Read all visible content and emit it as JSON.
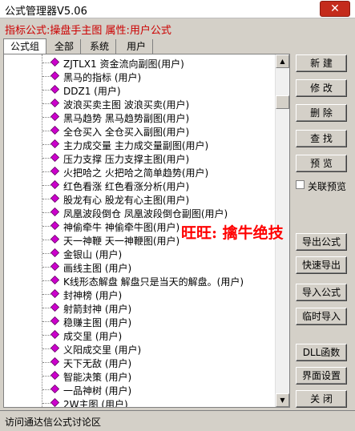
{
  "window": {
    "title": "公式管理器V5.06",
    "close_label": "✕"
  },
  "header": {
    "formula_info": "指标公式:操盘手主图 属性:用户公式"
  },
  "tabs": [
    "公式组",
    "全部",
    "系统",
    "用户"
  ],
  "tree": {
    "node_icon_color": "#cc00cc",
    "items": [
      "ZJTLX1 资金流向副图(用户)",
      "黑马的指标 (用户)",
      "DDZ1 (用户)",
      "波浪买卖主图 波浪买卖(用户)",
      "黑马趋势 黑马趋势副图(用户)",
      "全仓买入 全仓买入副图(用户)",
      "主力成交量 主力成交量副图(用户)",
      "压力支撑 压力支撑主图(用户)",
      "火把哈之 火把哈之简单趋势(用户)",
      "红色看涨 红色看涨分析(用户)",
      "股龙有心 股龙有心主图(用户)",
      "凤凰波段倒仓 凤凰波段倒仓副图(用户)",
      "神偷牵牛 神偷牵牛图(用户)",
      "天一神鞭 天一神鞭图(用户)",
      "金银山 (用户)",
      "画线主图 (用户)",
      "K线形态解盘 解盘只是当天的解盘。(用户)",
      "封神榜 (用户)",
      "射箭封神 (用户)",
      "稳赚主图 (用户)",
      "成交里 (用户)",
      "义阳成交里 (用户)",
      "天下无敌 (用户)",
      "智能决策 (用户)",
      "一品神树 (用户)",
      "2W主图 (用户)"
    ]
  },
  "buttons": {
    "new": "新 建",
    "modify": "修 改",
    "delete": "删 除",
    "find": "查 找",
    "preview": "预 览",
    "link_preview": "关联预览",
    "export": "导出公式",
    "quick_export": "快速导出",
    "import": "导入公式",
    "temp_import": "临时导入",
    "dll": "DLL函数",
    "ui_settings": "界面设置",
    "close": "关 闭"
  },
  "watermark": "旺旺: 擒牛绝技",
  "status": {
    "text": "访问通达信公式讨论区"
  },
  "colors": {
    "formula_text": "#cc0000",
    "watermark": "#ff0000",
    "close_button": "#c42b1c"
  }
}
